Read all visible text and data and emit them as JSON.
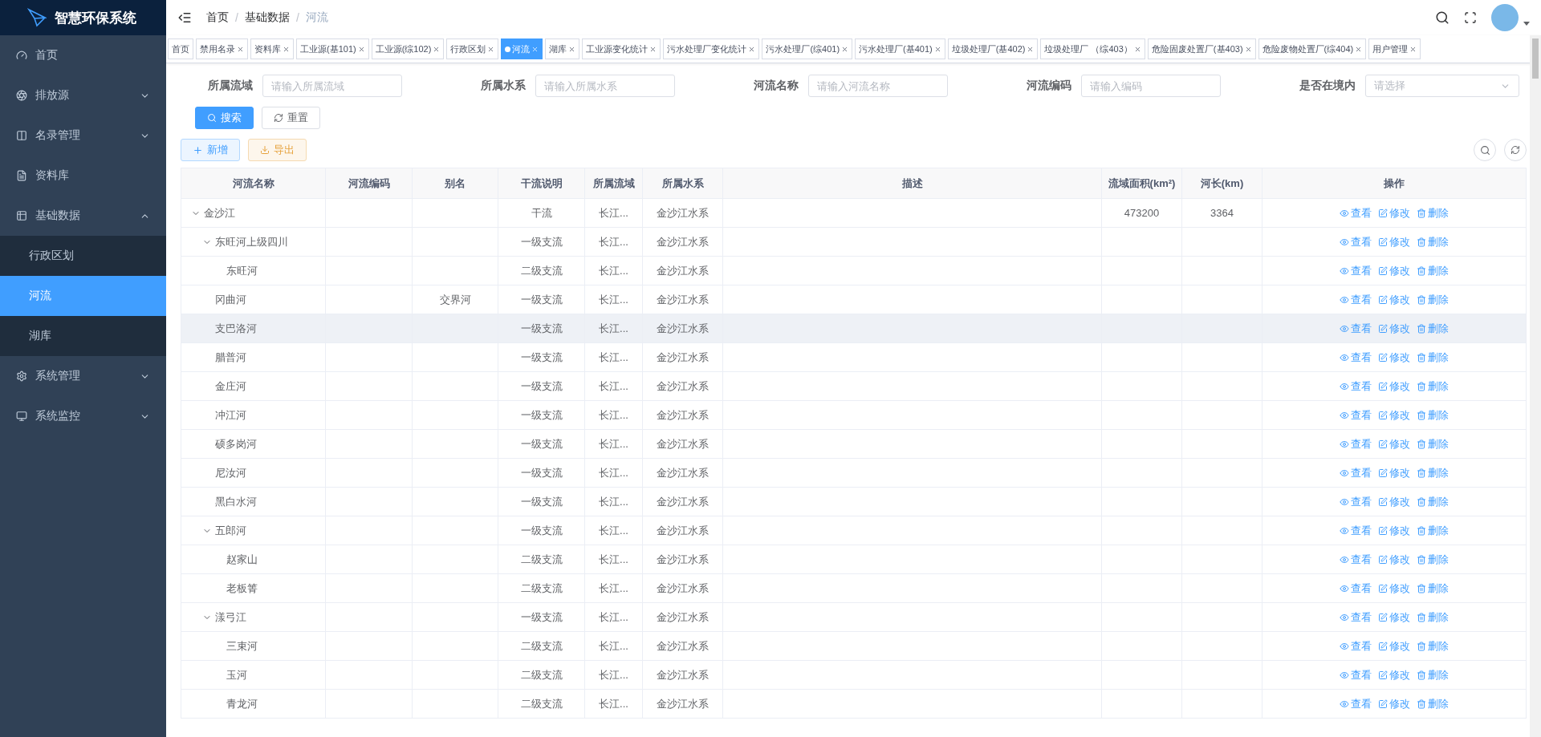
{
  "sidebar": {
    "title": "智慧环保系统",
    "items": [
      {
        "label": "首页",
        "kind": "dashboard",
        "selected": false
      },
      {
        "label": "排放源",
        "kind": "aperture",
        "selected": false,
        "expanded": false
      },
      {
        "label": "名录管理",
        "kind": "book",
        "selected": false,
        "expanded": false
      },
      {
        "label": "资料库",
        "kind": "file",
        "selected": false
      },
      {
        "label": "基础数据",
        "kind": "table",
        "selected": false,
        "expanded": true,
        "children": [
          {
            "label": "行政区划",
            "selected": false
          },
          {
            "label": "河流",
            "selected": true
          },
          {
            "label": "湖库",
            "selected": false
          }
        ]
      },
      {
        "label": "系统管理",
        "kind": "gear",
        "selected": false,
        "expanded": false
      },
      {
        "label": "系统监控",
        "kind": "monitor",
        "selected": false,
        "expanded": false
      }
    ]
  },
  "breadcrumb": [
    "首页",
    "基础数据",
    "河流"
  ],
  "breadcrumb_separator": "/",
  "tags": [
    {
      "label": "首页",
      "selected": false,
      "closable": false
    },
    {
      "label": "禁用名录",
      "selected": false,
      "closable": true
    },
    {
      "label": "资料库",
      "selected": false,
      "closable": true
    },
    {
      "label": "工业源(基101)",
      "selected": false,
      "closable": true
    },
    {
      "label": "工业源(综102)",
      "selected": false,
      "closable": true
    },
    {
      "label": "行政区划",
      "selected": false,
      "closable": true
    },
    {
      "label": "河流",
      "selected": true,
      "closable": true
    },
    {
      "label": "湖库",
      "selected": false,
      "closable": true
    },
    {
      "label": "工业源变化统计",
      "selected": false,
      "closable": true
    },
    {
      "label": "污水处理厂变化统计",
      "selected": false,
      "closable": true
    },
    {
      "label": "污水处理厂(综401)",
      "selected": false,
      "closable": true
    },
    {
      "label": "污水处理厂(基401)",
      "selected": false,
      "closable": true
    },
    {
      "label": "垃圾处理厂(基402)",
      "selected": false,
      "closable": true
    },
    {
      "label": "垃圾处理厂 （综403）",
      "selected": false,
      "closable": true
    },
    {
      "label": "危险固废处置厂(基403)",
      "selected": false,
      "closable": true
    },
    {
      "label": "危险废物处置厂(综404)",
      "selected": false,
      "closable": true
    },
    {
      "label": "用户管理",
      "selected": false,
      "closable": true
    }
  ],
  "filters": [
    {
      "label": "所属流域",
      "kind": "input",
      "placeholder": "请输入所属流域"
    },
    {
      "label": "所属水系",
      "kind": "input",
      "placeholder": "请输入所属水系"
    },
    {
      "label": "河流名称",
      "kind": "input",
      "placeholder": "请输入河流名称"
    },
    {
      "label": "河流编码",
      "kind": "input",
      "placeholder": "请输入编码"
    },
    {
      "label": "是否在境内",
      "kind": "select",
      "placeholder": "请选择"
    }
  ],
  "filter_buttons": [
    {
      "label": "搜索",
      "kind": "primary"
    },
    {
      "label": "重置",
      "kind": "reset"
    }
  ],
  "toolbar": [
    {
      "label": "新增",
      "kind": "add"
    },
    {
      "label": "导出",
      "kind": "export"
    }
  ],
  "table": {
    "columns": [
      "河流名称",
      "河流编码",
      "别名",
      "干流说明",
      "所属流域",
      "所属水系",
      "描述",
      "流域面积(km²)",
      "河长(km)",
      "操作"
    ],
    "rows": [
      {
        "name": "金沙江",
        "trunk": "干流",
        "basin": "长江...",
        "system": "金沙江水系",
        "area": "473200",
        "length": "3364",
        "hovered": false,
        "actions": [
          "查看",
          "修改",
          "删除"
        ],
        "expanded": true,
        "children": [
          {
            "name": "东旺河上级四川",
            "trunk": "一级支流",
            "basin": "长江...",
            "system": "金沙江水系",
            "hovered": false,
            "actions": [
              "查看",
              "修改",
              "删除"
            ],
            "expanded": true,
            "children": [
              {
                "name": "东旺河",
                "trunk": "二级支流",
                "basin": "长江...",
                "system": "金沙江水系",
                "hovered": false,
                "actions": [
                  "查看",
                  "修改",
                  "删除"
                ]
              }
            ]
          },
          {
            "name": "冈曲河",
            "alias": "交界河",
            "trunk": "一级支流",
            "basin": "长江...",
            "system": "金沙江水系",
            "hovered": false,
            "actions": [
              "查看",
              "修改",
              "删除"
            ]
          },
          {
            "name": "支巴洛河",
            "trunk": "一级支流",
            "basin": "长江...",
            "system": "金沙江水系",
            "hovered": true,
            "actions": [
              "查看",
              "修改",
              "删除"
            ]
          },
          {
            "name": "腊普河",
            "trunk": "一级支流",
            "basin": "长江...",
            "system": "金沙江水系",
            "hovered": false,
            "actions": [
              "查看",
              "修改",
              "删除"
            ]
          },
          {
            "name": "金庄河",
            "trunk": "一级支流",
            "basin": "长江...",
            "system": "金沙江水系",
            "hovered": false,
            "actions": [
              "查看",
              "修改",
              "删除"
            ]
          },
          {
            "name": "冲江河",
            "trunk": "一级支流",
            "basin": "长江...",
            "system": "金沙江水系",
            "hovered": false,
            "actions": [
              "查看",
              "修改",
              "删除"
            ]
          },
          {
            "name": "硕多岗河",
            "trunk": "一级支流",
            "basin": "长江...",
            "system": "金沙江水系",
            "hovered": false,
            "actions": [
              "查看",
              "修改",
              "删除"
            ]
          },
          {
            "name": "尼汝河",
            "trunk": "一级支流",
            "basin": "长江...",
            "system": "金沙江水系",
            "hovered": false,
            "actions": [
              "查看",
              "修改",
              "删除"
            ]
          },
          {
            "name": "黑白水河",
            "trunk": "一级支流",
            "basin": "长江...",
            "system": "金沙江水系",
            "hovered": false,
            "actions": [
              "查看",
              "修改",
              "删除"
            ]
          },
          {
            "name": "五郎河",
            "trunk": "一级支流",
            "basin": "长江...",
            "system": "金沙江水系",
            "hovered": false,
            "actions": [
              "查看",
              "修改",
              "删除"
            ],
            "expanded": true,
            "children": [
              {
                "name": "赵家山",
                "trunk": "二级支流",
                "basin": "长江...",
                "system": "金沙江水系",
                "hovered": false,
                "actions": [
                  "查看",
                  "修改",
                  "删除"
                ]
              },
              {
                "name": "老板箐",
                "trunk": "二级支流",
                "basin": "长江...",
                "system": "金沙江水系",
                "hovered": false,
                "actions": [
                  "查看",
                  "修改",
                  "删除"
                ]
              }
            ]
          },
          {
            "name": "漾弓江",
            "trunk": "一级支流",
            "basin": "长江...",
            "system": "金沙江水系",
            "hovered": false,
            "actions": [
              "查看",
              "修改",
              "删除"
            ],
            "expanded": true,
            "children": [
              {
                "name": "三束河",
                "trunk": "二级支流",
                "basin": "长江...",
                "system": "金沙江水系",
                "hovered": false,
                "actions": [
                  "查看",
                  "修改",
                  "删除"
                ]
              },
              {
                "name": "玉河",
                "trunk": "二级支流",
                "basin": "长江...",
                "system": "金沙江水系",
                "hovered": false,
                "actions": [
                  "查看",
                  "修改",
                  "删除"
                ]
              },
              {
                "name": "青龙河",
                "trunk": "二级支流",
                "basin": "长江...",
                "system": "金沙江水系",
                "hovered": false,
                "actions": [
                  "查看",
                  "修改",
                  "删除"
                ]
              }
            ]
          }
        ]
      }
    ]
  }
}
